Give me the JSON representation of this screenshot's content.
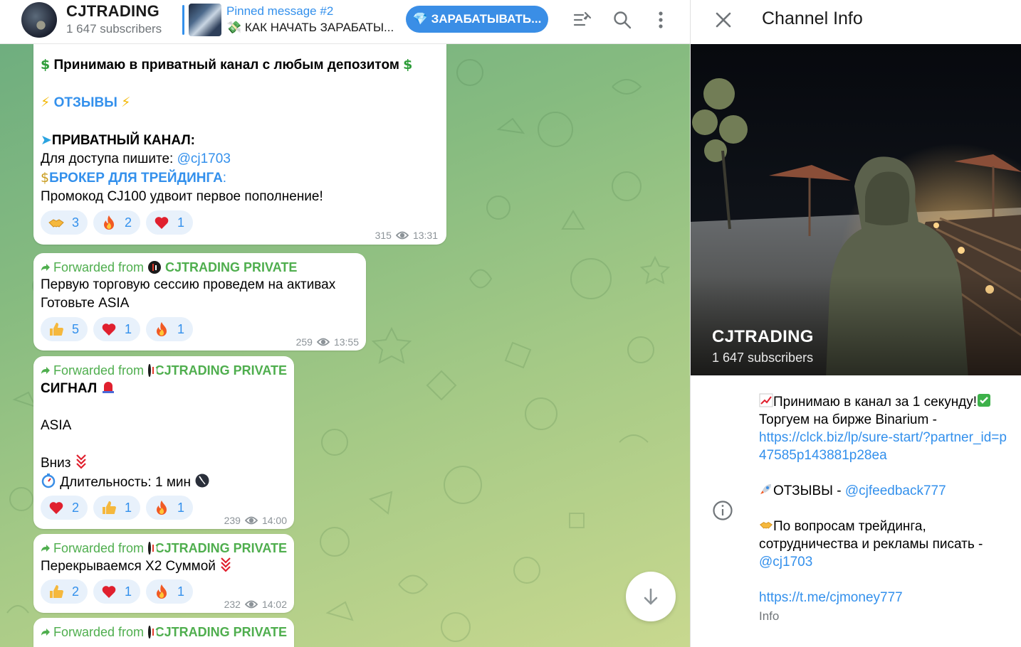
{
  "header": {
    "channel_title": "CJTRADING",
    "subscribers": "1 647 subscribers",
    "pinned_title": "Pinned message #2",
    "pinned_text": "💸 КАК НАЧАТЬ ЗАРАБАТЫ...",
    "earn_button": "💎 ЗАРАБАТЫВАТЬ..."
  },
  "messages": {
    "m1": {
      "line1": "Принимаю в приватный канал с любым депозитом",
      "reviews": "ОТЗЫВЫ",
      "private_channel": "ПРИВАТНЫЙ КАНАЛ:",
      "access_text": "Для доступа пишите: ",
      "access_link": "@cj1703",
      "broker": "БРОКЕР ДЛЯ ТРЕЙДИНГА",
      "broker_colon": ":",
      "promo": "Промокод CJ100 удвоит первое пополнение!",
      "reactions": [
        {
          "emoji": "handshake-emoji",
          "count": "3"
        },
        {
          "emoji": "fire-emoji",
          "count": "2"
        },
        {
          "emoji": "heart-emoji",
          "count": "1"
        }
      ],
      "views": "315",
      "time": "13:31"
    },
    "m2": {
      "forwarded_label": "Forwarded from",
      "forwarded_source": "CJTRADING PRIVATE",
      "line1": "Первую торговую сессию проведем на активах",
      "line2": "Готовьте ASIA",
      "reactions": [
        {
          "emoji": "thumbs-up-emoji",
          "count": "5"
        },
        {
          "emoji": "heart-emoji",
          "count": "1"
        },
        {
          "emoji": "fire-emoji",
          "count": "1"
        }
      ],
      "views": "259",
      "time": "13:55"
    },
    "m3": {
      "forwarded_label": "Forwarded from",
      "forwarded_source": "CJTRADING PRIVATE",
      "signal": "СИГНАЛ",
      "asset": "ASIA",
      "direction": "Вниз",
      "duration": "Длительность: 1 мин",
      "reactions": [
        {
          "emoji": "heart-emoji",
          "count": "2"
        },
        {
          "emoji": "thumbs-up-emoji",
          "count": "1"
        },
        {
          "emoji": "fire-emoji",
          "count": "1"
        }
      ],
      "views": "239",
      "time": "14:00"
    },
    "m4": {
      "forwarded_label": "Forwarded from",
      "forwarded_source": "CJTRADING PRIVATE",
      "line1": "Перекрываемся Х2 Суммой",
      "reactions": [
        {
          "emoji": "thumbs-up-emoji",
          "count": "2"
        },
        {
          "emoji": "heart-emoji",
          "count": "1"
        },
        {
          "emoji": "fire-emoji",
          "count": "1"
        }
      ],
      "views": "232",
      "time": "14:02"
    },
    "m5": {
      "forwarded_label": "Forwarded from",
      "forwarded_source": "CJTRADING PRIVATE"
    }
  },
  "info": {
    "title": "Channel Info",
    "photo_title": "CJTRADING",
    "photo_subs": "1 647 subscribers",
    "desc": {
      "l1": "Принимаю в канал за 1 секунду!",
      "l2": "Торгуем на бирже Binarium -",
      "link1": "https://clck.biz/lp/sure-start/?partner_id=p47585p143881p28ea",
      "reviews": "ОТЗЫВЫ - ",
      "reviews_link": "@cjfeedback777",
      "q1": "По вопросам трейдинга,",
      "q2": "сотрудничества и рекламы писать -",
      "q_link": "@cj1703",
      "link2": "https://t.me/cjmoney777"
    },
    "label": "Info"
  },
  "colors": {
    "accent": "#3390ec",
    "forward_green": "#4fae4e",
    "reaction_bg": "#e8f1fb"
  }
}
